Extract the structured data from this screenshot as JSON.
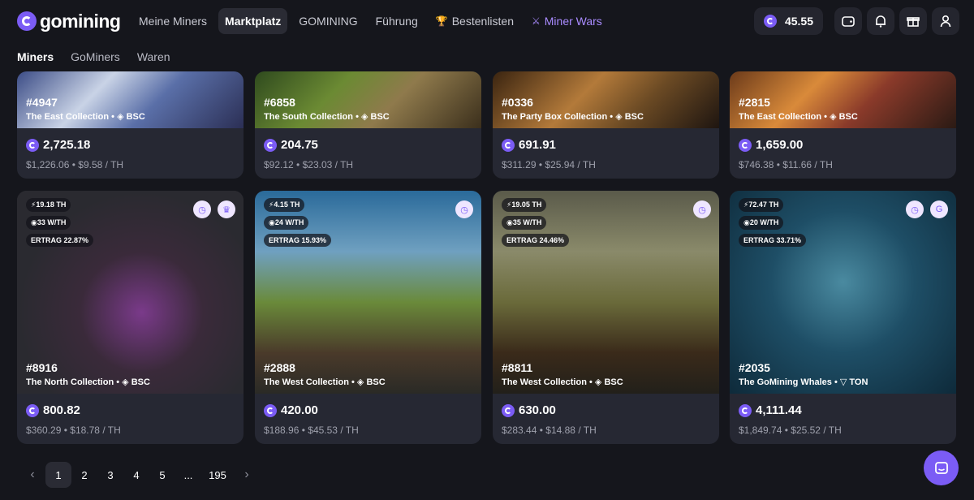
{
  "brand": "gomining",
  "nav": [
    "Meine Miners",
    "Marktplatz",
    "GOMINING",
    "Führung",
    "Bestenlisten",
    "Miner Wars"
  ],
  "balance": "45.55",
  "subnav": [
    "Miners",
    "GoMiners",
    "Waren"
  ],
  "top_cards": [
    {
      "id": "#4947",
      "collection": "The East Collection",
      "chain": "BSC",
      "price": "2,725.18",
      "usd": "$1,226.06",
      "per_th": "$9.58 / TH"
    },
    {
      "id": "#6858",
      "collection": "The South Collection",
      "chain": "BSC",
      "price": "204.75",
      "usd": "$92.12",
      "per_th": "$23.03 / TH"
    },
    {
      "id": "#0336",
      "collection": "The Party Box Collection",
      "chain": "BSC",
      "price": "691.91",
      "usd": "$311.29",
      "per_th": "$25.94 / TH"
    },
    {
      "id": "#2815",
      "collection": "The East Collection",
      "chain": "BSC",
      "price": "1,659.00",
      "usd": "$746.38",
      "per_th": "$11.66 / TH"
    }
  ],
  "cards": [
    {
      "power": "19.18 TH",
      "eff": "33 W/TH",
      "yield": "ERTRAG 22.87%",
      "id": "#8916",
      "collection": "The North Collection",
      "chain": "BSC",
      "price": "800.82",
      "usd": "$360.29",
      "per_th": "$18.78 / TH"
    },
    {
      "power": "4.15 TH",
      "eff": "24 W/TH",
      "yield": "ERTRAG 15.93%",
      "id": "#2888",
      "collection": "The West Collection",
      "chain": "BSC",
      "price": "420.00",
      "usd": "$188.96",
      "per_th": "$45.53 / TH"
    },
    {
      "power": "19.05 TH",
      "eff": "35 W/TH",
      "yield": "ERTRAG 24.46%",
      "id": "#8811",
      "collection": "The West Collection",
      "chain": "BSC",
      "price": "630.00",
      "usd": "$283.44",
      "per_th": "$14.88 / TH"
    },
    {
      "power": "72.47 TH",
      "eff": "20 W/TH",
      "yield": "ERTRAG 33.71%",
      "id": "#2035",
      "collection": "The GoMining Whales",
      "chain": "TON",
      "price": "4,111.44",
      "usd": "$1,849.74",
      "per_th": "$25.52 / TH"
    }
  ],
  "pagination": {
    "pages": [
      "1",
      "2",
      "3",
      "4",
      "5",
      "...",
      "195"
    ]
  },
  "sep": "•",
  "colors": {
    "accent": "#7b5cf5",
    "bg": "#15161c",
    "card": "#262833"
  }
}
